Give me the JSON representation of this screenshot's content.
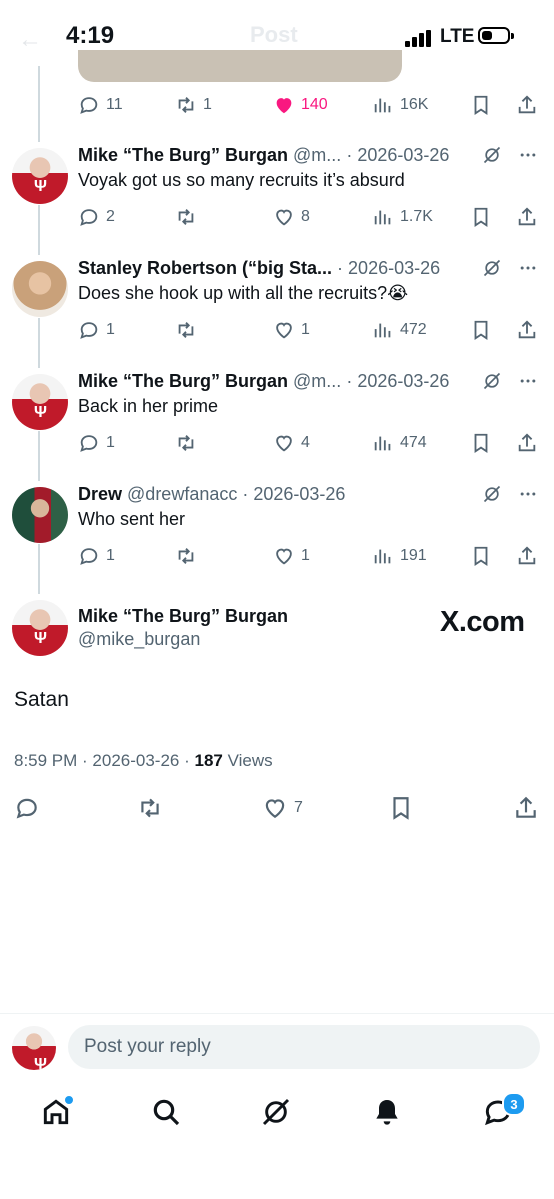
{
  "status_bar": {
    "time": "4:19",
    "network": "LTE",
    "ghost_title": "Post"
  },
  "previous_post_actions": {
    "replies": "11",
    "reposts": "1",
    "likes": "140",
    "views": "16K"
  },
  "replies": [
    {
      "name": "Mike “The Burg” Burgan",
      "handle": "@m...",
      "date": "· 2026-03-26",
      "text": "Voyak got us so many recruits it’s absurd",
      "replies": "2",
      "reposts": "",
      "likes": "8",
      "views": "1.7K"
    },
    {
      "name": "Stanley Robertson (“big Sta...",
      "handle": "",
      "date": "· 2026-03-26",
      "text": "Does she hook up with all the recruits?😭",
      "replies": "1",
      "reposts": "",
      "likes": "1",
      "views": "472"
    },
    {
      "name": "Mike “The Burg” Burgan",
      "handle": "@m...",
      "date": "· 2026-03-26",
      "text": "Back in her prime",
      "replies": "1",
      "reposts": "",
      "likes": "4",
      "views": "474"
    },
    {
      "name": "Drew",
      "handle": "@drewfanacc",
      "date": "· 2026-03-26",
      "text": "Who sent her",
      "replies": "1",
      "reposts": "",
      "likes": "1",
      "views": "191"
    }
  ],
  "main_post": {
    "name": "Mike “The Burg” Burgan",
    "handle": "@mike_burgan",
    "watermark": "X.com",
    "text": "Satan",
    "time_date": "8:59 PM · 2026-03-26 · ",
    "views_count": "187",
    "views_label": " Views",
    "likes": "7"
  },
  "reply_bar": {
    "placeholder": "Post your reply"
  },
  "tabbar": {
    "messages_badge": "3"
  },
  "colors": {
    "accent": "#1d9bf0",
    "like": "#f91880",
    "muted": "#536471"
  }
}
